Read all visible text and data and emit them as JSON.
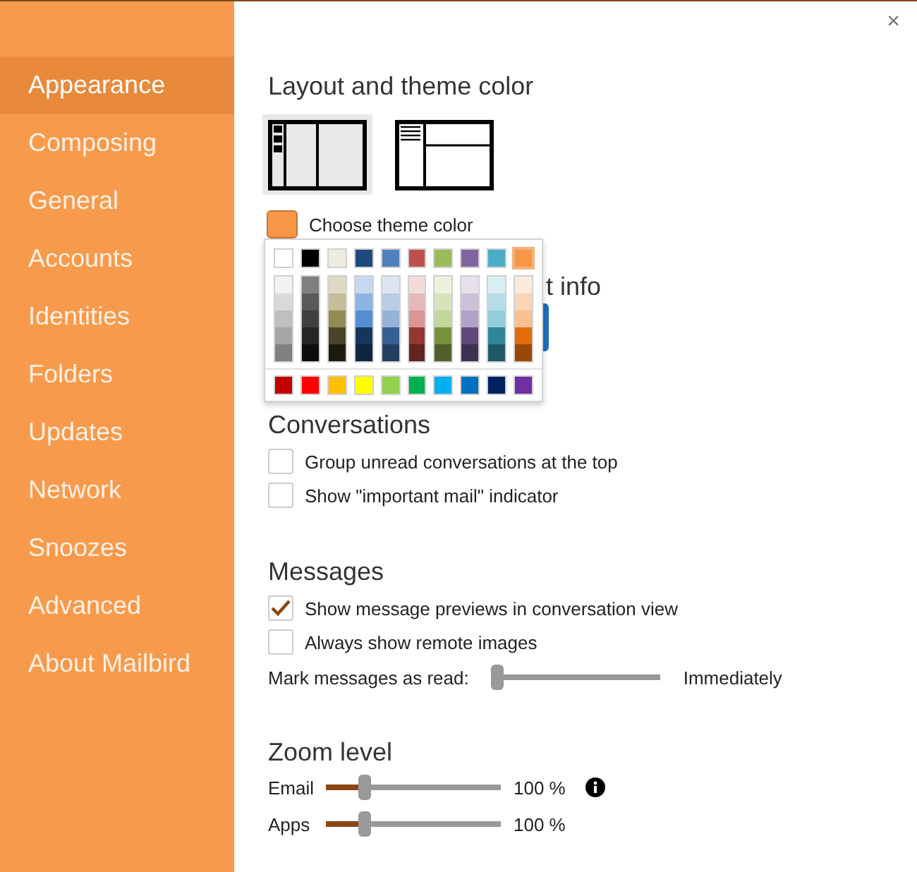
{
  "sidebar": {
    "items": [
      {
        "label": "Appearance",
        "selected": true
      },
      {
        "label": "Composing",
        "selected": false
      },
      {
        "label": "General",
        "selected": false
      },
      {
        "label": "Accounts",
        "selected": false
      },
      {
        "label": "Identities",
        "selected": false
      },
      {
        "label": "Folders",
        "selected": false
      },
      {
        "label": "Updates",
        "selected": false
      },
      {
        "label": "Network",
        "selected": false
      },
      {
        "label": "Snoozes",
        "selected": false
      },
      {
        "label": "Advanced",
        "selected": false
      },
      {
        "label": "About Mailbird",
        "selected": false
      }
    ]
  },
  "close": "×",
  "layout_section": {
    "title": "Layout and theme color",
    "layouts": [
      {
        "kind": "sidebar",
        "selected": true
      },
      {
        "kind": "split",
        "selected": false
      }
    ],
    "theme_button": {
      "label": "Choose theme color",
      "color": "#f79646"
    }
  },
  "color_picker": {
    "theme_colors": [
      {
        "color": "#ffffff",
        "selected": false
      },
      {
        "color": "#000000",
        "selected": false
      },
      {
        "color": "#eeece1",
        "selected": false
      },
      {
        "color": "#1f497d",
        "selected": false
      },
      {
        "color": "#4f81bd",
        "selected": false
      },
      {
        "color": "#c0504d",
        "selected": false
      },
      {
        "color": "#9bbb59",
        "selected": false
      },
      {
        "color": "#8064a2",
        "selected": false
      },
      {
        "color": "#4bacc6",
        "selected": false
      },
      {
        "color": "#f79646",
        "selected": true
      }
    ],
    "shades": [
      {
        "shades": [
          {
            "color": "#f2f2f2"
          },
          {
            "color": "#d9d9d9"
          },
          {
            "color": "#bfbfbf"
          },
          {
            "color": "#a6a6a6"
          },
          {
            "color": "#808080"
          }
        ]
      },
      {
        "shades": [
          {
            "color": "#7f7f7f"
          },
          {
            "color": "#595959"
          },
          {
            "color": "#404040"
          },
          {
            "color": "#262626"
          },
          {
            "color": "#0d0d0d"
          }
        ]
      },
      {
        "shades": [
          {
            "color": "#ddd9c3"
          },
          {
            "color": "#c4bd97"
          },
          {
            "color": "#948a54"
          },
          {
            "color": "#4a452a"
          },
          {
            "color": "#1d1b10"
          }
        ]
      },
      {
        "shades": [
          {
            "color": "#c6d9f0"
          },
          {
            "color": "#8db3e2"
          },
          {
            "color": "#548dd4"
          },
          {
            "color": "#17365d"
          },
          {
            "color": "#0f243e"
          }
        ]
      },
      {
        "shades": [
          {
            "color": "#dbe5f1"
          },
          {
            "color": "#b8cce4"
          },
          {
            "color": "#95b3d7"
          },
          {
            "color": "#366092"
          },
          {
            "color": "#244061"
          }
        ]
      },
      {
        "shades": [
          {
            "color": "#f2dcdb"
          },
          {
            "color": "#e5b9b7"
          },
          {
            "color": "#d99694"
          },
          {
            "color": "#953734"
          },
          {
            "color": "#632423"
          }
        ]
      },
      {
        "shades": [
          {
            "color": "#ebf1dd"
          },
          {
            "color": "#d7e3bc"
          },
          {
            "color": "#c3d69b"
          },
          {
            "color": "#76923c"
          },
          {
            "color": "#4f6128"
          }
        ]
      },
      {
        "shades": [
          {
            "color": "#e5e0ec"
          },
          {
            "color": "#ccc1d9"
          },
          {
            "color": "#b2a2c7"
          },
          {
            "color": "#5f497a"
          },
          {
            "color": "#3f3151"
          }
        ]
      },
      {
        "shades": [
          {
            "color": "#dbeef3"
          },
          {
            "color": "#b7dde8"
          },
          {
            "color": "#92cddc"
          },
          {
            "color": "#31859b"
          },
          {
            "color": "#205867"
          }
        ]
      },
      {
        "shades": [
          {
            "color": "#fdeada"
          },
          {
            "color": "#fbd5b5"
          },
          {
            "color": "#fac08f"
          },
          {
            "color": "#e36c09"
          },
          {
            "color": "#974806"
          }
        ]
      }
    ],
    "standard_colors": [
      {
        "color": "#c00000"
      },
      {
        "color": "#ff0000"
      },
      {
        "color": "#ffc000"
      },
      {
        "color": "#ffff00"
      },
      {
        "color": "#92d050"
      },
      {
        "color": "#00b050"
      },
      {
        "color": "#00b0f0"
      },
      {
        "color": "#0070c0"
      },
      {
        "color": "#002060"
      },
      {
        "color": "#7030a0"
      }
    ]
  },
  "hidden_section": {
    "title": "t info"
  },
  "conversations": {
    "title": "Conversations",
    "options": [
      {
        "label": "Group unread conversations at the top",
        "checked": false
      },
      {
        "label": "Show \"important mail\" indicator",
        "checked": false
      }
    ]
  },
  "messages": {
    "title": "Messages",
    "options": [
      {
        "label": "Show message previews in conversation view",
        "checked": true
      },
      {
        "label": "Always show remote images",
        "checked": false
      }
    ],
    "mark_read": {
      "label": "Mark messages as read:",
      "level": 0,
      "reading": "Immediately"
    }
  },
  "zoom": {
    "title": "Zoom level",
    "sliders": [
      {
        "label": "Email",
        "level": 0.2,
        "reading": "100 %",
        "info": true
      },
      {
        "label": "Apps",
        "level": 0.2,
        "reading": "100 %",
        "info": false
      }
    ]
  }
}
